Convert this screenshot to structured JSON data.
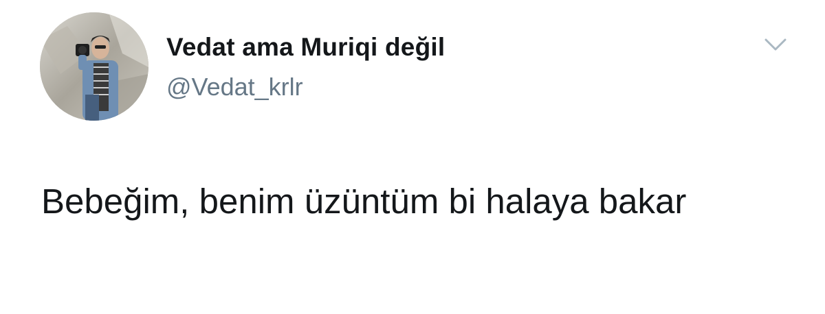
{
  "tweet": {
    "author": {
      "display_name": "Vedat ama Muriqi değil",
      "handle": "@Vedat_krlr",
      "avatar_icon": "profile-photo"
    },
    "menu_icon": "chevron-down-icon",
    "text": "Bebeğim, benim üzüntüm bi halaya bakar"
  },
  "colors": {
    "name": "#14171a",
    "handle": "#657786",
    "chevron": "#aab8c2",
    "background": "#ffffff"
  }
}
